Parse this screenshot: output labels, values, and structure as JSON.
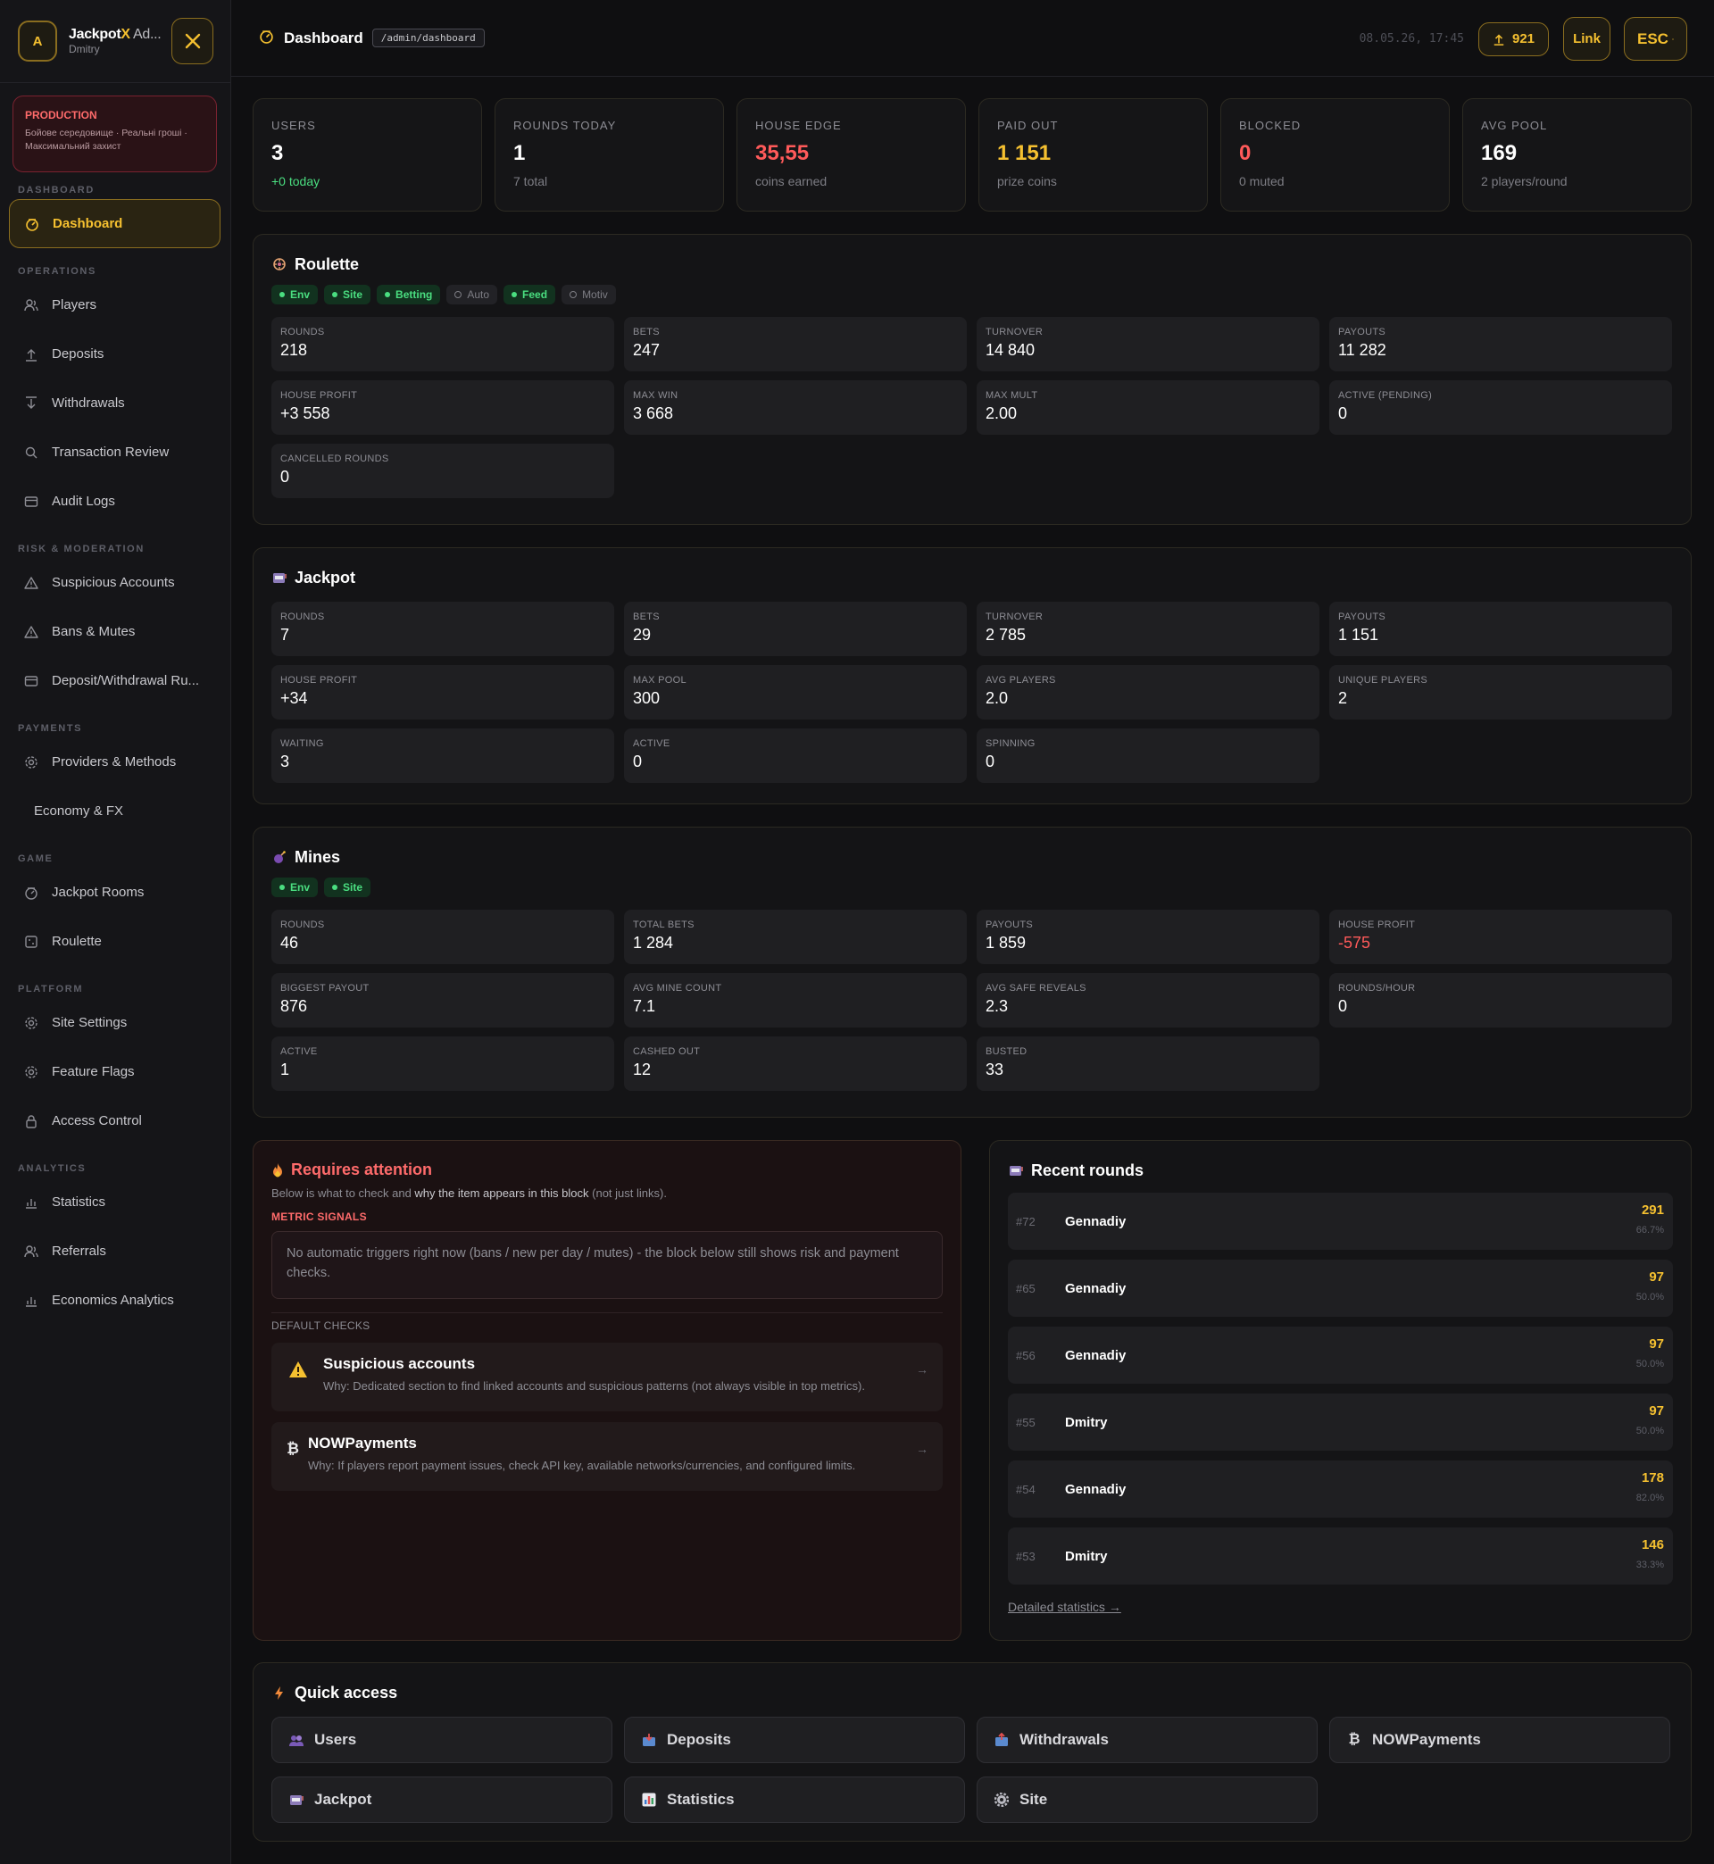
{
  "app": {
    "brand_main": "Jackpot",
    "brand_x": "X",
    "brand_rest": " Ad...",
    "user": "Dmitry",
    "avatar_letter": "A"
  },
  "production": {
    "title": "PRODUCTION",
    "desc": "Бойове середовище · Реальні гроші · Максимальний захист"
  },
  "sidebar": {
    "sections": {
      "dashboard": "DASHBOARD",
      "operations": "OPERATIONS",
      "risk": "RISK & MODERATION",
      "payments": "PAYMENTS",
      "game": "GAME",
      "platform": "PLATFORM",
      "analytics": "ANALYTICS"
    },
    "items": {
      "dashboard": "Dashboard",
      "players": "Players",
      "deposits": "Deposits",
      "withdrawals": "Withdrawals",
      "transaction_review": "Transaction Review",
      "audit_logs": "Audit Logs",
      "suspicious": "Suspicious Accounts",
      "bans": "Bans & Mutes",
      "dw_rules": "Deposit/Withdrawal Ru...",
      "providers": "Providers & Methods",
      "economy": "Economy & FX",
      "jackpot_rooms": "Jackpot Rooms",
      "roulette": "Roulette",
      "site_settings": "Site Settings",
      "feature_flags": "Feature Flags",
      "access_control": "Access Control",
      "statistics": "Statistics",
      "referrals": "Referrals",
      "economics": "Economics Analytics"
    }
  },
  "topbar": {
    "title": "Dashboard",
    "path": "/admin/dashboard",
    "timestamp": "08.05.26, 17:45",
    "count": "921",
    "link": "Link",
    "esc": "ESC"
  },
  "stats": [
    {
      "label": "USERS",
      "value": "3",
      "sub": "+0 today"
    },
    {
      "label": "ROUNDS TODAY",
      "value": "1",
      "sub": "7 total"
    },
    {
      "label": "HOUSE EDGE",
      "value": "35,55",
      "sub": "coins earned"
    },
    {
      "label": "PAID OUT",
      "value": "1 151",
      "sub": "prize coins"
    },
    {
      "label": "BLOCKED",
      "value": "0",
      "sub": "0 muted"
    },
    {
      "label": "AVG POOL",
      "value": "169",
      "sub": "2 players/round"
    }
  ],
  "roulette": {
    "title": "Roulette",
    "tags": [
      "Env",
      "Site",
      "Betting",
      "Auto",
      "Feed",
      "Motiv"
    ],
    "metrics": [
      {
        "label": "ROUNDS",
        "value": "218"
      },
      {
        "label": "BETS",
        "value": "247"
      },
      {
        "label": "TURNOVER",
        "value": "14 840"
      },
      {
        "label": "PAYOUTS",
        "value": "11 282"
      },
      {
        "label": "HOUSE PROFIT",
        "value": "+3 558"
      },
      {
        "label": "MAX WIN",
        "value": "3 668"
      },
      {
        "label": "MAX MULT",
        "value": "2.00"
      },
      {
        "label": "ACTIVE (PENDING)",
        "value": "0"
      },
      {
        "label": "CANCELLED ROUNDS",
        "value": "0"
      }
    ]
  },
  "jackpot": {
    "title": "Jackpot",
    "metrics": [
      {
        "label": "ROUNDS",
        "value": "7"
      },
      {
        "label": "BETS",
        "value": "29"
      },
      {
        "label": "TURNOVER",
        "value": "2 785"
      },
      {
        "label": "PAYOUTS",
        "value": "1 151"
      },
      {
        "label": "HOUSE PROFIT",
        "value": "+34"
      },
      {
        "label": "MAX POOL",
        "value": "300"
      },
      {
        "label": "AVG PLAYERS",
        "value": "2.0"
      },
      {
        "label": "UNIQUE PLAYERS",
        "value": "2"
      },
      {
        "label": "WAITING",
        "value": "3"
      },
      {
        "label": "ACTIVE",
        "value": "0"
      },
      {
        "label": "SPINNING",
        "value": "0"
      }
    ]
  },
  "mines": {
    "title": "Mines",
    "tags": [
      "Env",
      "Site"
    ],
    "metrics": [
      {
        "label": "ROUNDS",
        "value": "46"
      },
      {
        "label": "TOTAL BETS",
        "value": "1 284"
      },
      {
        "label": "PAYOUTS",
        "value": "1 859"
      },
      {
        "label": "HOUSE PROFIT",
        "value": "-575"
      },
      {
        "label": "BIGGEST PAYOUT",
        "value": "876"
      },
      {
        "label": "AVG MINE COUNT",
        "value": "7.1"
      },
      {
        "label": "AVG SAFE REVEALS",
        "value": "2.3"
      },
      {
        "label": "ROUNDS/HOUR",
        "value": "0"
      },
      {
        "label": "ACTIVE",
        "value": "1"
      },
      {
        "label": "CASHED OUT",
        "value": "12"
      },
      {
        "label": "BUSTED",
        "value": "33"
      }
    ]
  },
  "attention": {
    "title": "Requires attention",
    "sub_a": "Below is what to check and ",
    "sub_b": "why the item appears in this block",
    "sub_c": " (not just links).",
    "metric_signals": "METRIC SIGNALS",
    "no_triggers": "No automatic triggers right now (bans / new per day / mutes) - the block below still shows risk and payment checks.",
    "default_checks": "DEFAULT CHECKS",
    "checks": [
      {
        "title": "Suspicious accounts",
        "why": "Why: Dedicated section to find linked accounts and suspicious patterns (not always visible in top metrics)."
      },
      {
        "title": "NOWPayments",
        "why": "Why: If players report payment issues, check API key, available networks/currencies, and configured limits."
      }
    ]
  },
  "recent": {
    "title": "Recent rounds",
    "rows": [
      {
        "id": "#72",
        "name": "Gennadiy",
        "amount": "291",
        "pct": "66.7%"
      },
      {
        "id": "#65",
        "name": "Gennadiy",
        "amount": "97",
        "pct": "50.0%"
      },
      {
        "id": "#56",
        "name": "Gennadiy",
        "amount": "97",
        "pct": "50.0%"
      },
      {
        "id": "#55",
        "name": "Dmitry",
        "amount": "97",
        "pct": "50.0%"
      },
      {
        "id": "#54",
        "name": "Gennadiy",
        "amount": "178",
        "pct": "82.0%"
      },
      {
        "id": "#53",
        "name": "Dmitry",
        "amount": "146",
        "pct": "33.3%"
      }
    ],
    "detailed": "Detailed statistics →"
  },
  "quick": {
    "title": "Quick access",
    "items": [
      "Users",
      "Deposits",
      "Withdrawals",
      "NOWPayments",
      "Jackpot",
      "Statistics",
      "Site"
    ]
  },
  "colors": {
    "accent": "#f5c030",
    "danger": "#ff5a5a",
    "success": "#4ade80",
    "bg": "#0f0f11"
  }
}
